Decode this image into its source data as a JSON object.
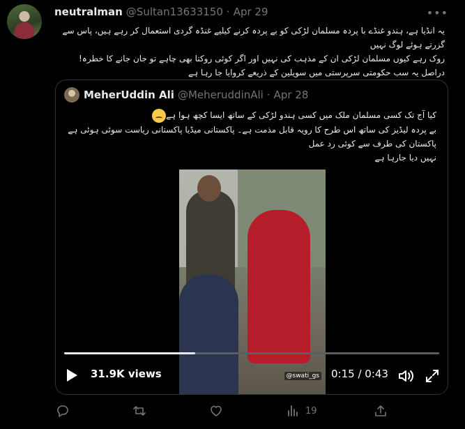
{
  "tweet": {
    "author_name": "neutralman",
    "handle": "@Sultan13633150",
    "separator": "·",
    "date": "Apr 29",
    "lines": [
      "یہ انڈیا ہے، ہندو غنڈے با پردہ مسلمان لڑکی کو بے پردہ کرنے کیلیے غنڈہ گردی استعمال کر رہے ہیں، پاس سے گزرتے ہوئے لوگ نہیں",
      "روک رہے کیوں مسلمان لڑکی ان کے مذہب کی نہیں اور اگر کوئی روکتا بھی چاہے تو جان جانے کا خطرہ!",
      "دراصل یہ سب حکومتی سرپرستی میں سویلین کے ذریعے کروایا جا رہا ہے"
    ]
  },
  "quoted": {
    "author_name": "MeherUddin Ali",
    "handle": "@MeheruddinAli",
    "separator": "·",
    "date": "Apr 28",
    "lines": [
      "کیا آج تک کسی مسلمان ملک میں کسی ہندو لڑکی کے ساتھ ایسا کچھ ہوا ہے",
      "بے پردہ لیڈیز کی ساتھ اس طرح کا رویہ قابل مذمت ہے۔ پاکستانی میڈیا پاکستانی ریاست سوئی ہوئی ہے پاکستان کی طرف سے کوئی رد عمل",
      "نہیں دیا جارہا ہے"
    ],
    "emoji": "sad-face-emoji"
  },
  "video": {
    "views": "31.9K views",
    "time": "0:15 / 0:43",
    "progress": 0.35,
    "watermark": "@swati_gs"
  },
  "actions": {
    "reply_count": "",
    "retweet_count": "",
    "like_count": "",
    "views_count": "19"
  }
}
